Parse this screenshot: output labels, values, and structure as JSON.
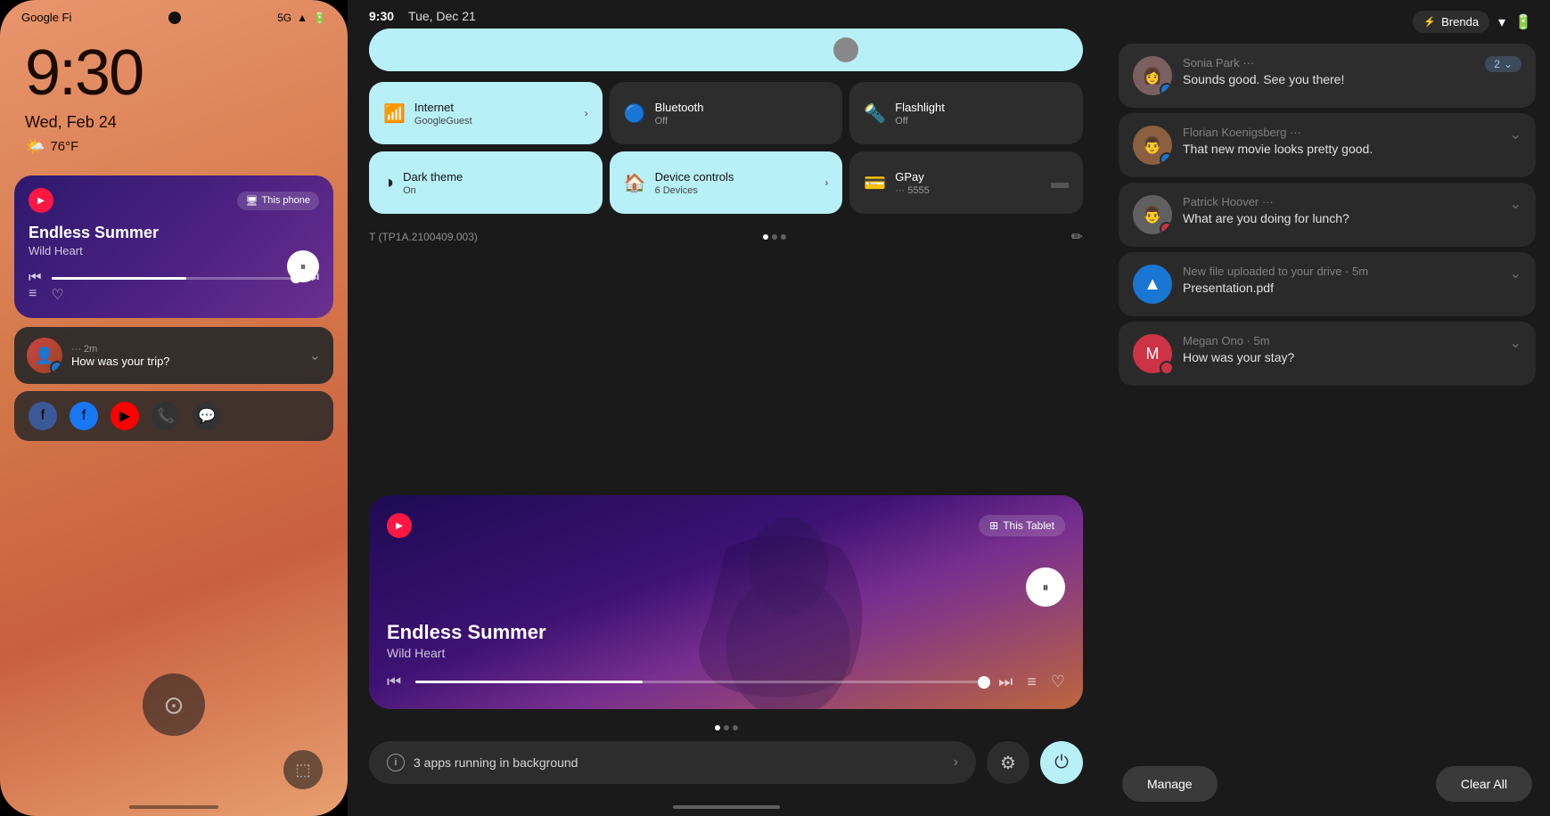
{
  "phone": {
    "carrier": "Google Fi",
    "network": "5G",
    "time": "9:30",
    "date": "Wed, Feb 24",
    "weather": "76°F",
    "weather_icon": "🌤",
    "music": {
      "title": "Endless Summer",
      "artist": "Wild Heart",
      "this_device_label": "This phone",
      "pause_icon": "⏸"
    },
    "notification": {
      "sender": "···  2m",
      "message": "How was your trip?",
      "expand_icon": "⌄"
    },
    "fingerprint_icon": "⊙",
    "recents_icon": "⬚"
  },
  "tablet": {
    "status_time": "9:30",
    "status_date": "Tue, Dec 21",
    "brightness_icon": "☀",
    "quick_settings": {
      "internet": {
        "label": "Internet",
        "sub": "GoogleGuest",
        "active": true,
        "icon": "📶"
      },
      "bluetooth": {
        "label": "Bluetooth",
        "sub": "Off",
        "active": false,
        "icon": "🔵"
      },
      "flashlight": {
        "label": "Flashlight",
        "sub": "Off",
        "active": false,
        "icon": "🔦"
      },
      "dark_theme": {
        "label": "Dark theme",
        "sub": "On",
        "active": true,
        "icon": "◑"
      },
      "device_controls": {
        "label": "Device controls",
        "sub": "6 Devices",
        "active": true,
        "icon": "🏠",
        "has_arrow": true
      },
      "gpay": {
        "label": "GPay",
        "sub": "··· 5555",
        "active": false,
        "icon": "💳"
      }
    },
    "device_build": "T (TP1A.2100409.003)",
    "music": {
      "title": "Endless Summer",
      "artist": "Wild Heart",
      "this_device_label": "This Tablet"
    },
    "background_apps": "3 apps running in background",
    "settings_icon": "⚙",
    "power_icon": "⏻"
  },
  "notifications": {
    "user_name": "Brenda",
    "items": [
      {
        "sender": "Sonia Park ···",
        "message": "Sounds good. See you there!",
        "has_count": true,
        "count": "2",
        "avatar_color": "#7a6060",
        "app_badge_color": "#1976d2"
      },
      {
        "sender": "Florian Koenigsberg ···",
        "message": "That new movie looks pretty good.",
        "has_count": false,
        "avatar_color": "#8a6040",
        "app_badge_color": "#1976d2"
      },
      {
        "sender": "Patrick Hoover ···",
        "message": "What are you doing for lunch?",
        "has_count": false,
        "avatar_color": "#606060",
        "app_badge_color": "#cc3344"
      },
      {
        "sender": "New file uploaded to your drive",
        "time": "5m",
        "message": "Presentation.pdf",
        "has_count": false,
        "type": "drive"
      },
      {
        "sender": "Megan Ono",
        "time": "5m",
        "message": "How was your stay?",
        "has_count": false,
        "avatar_color": "#cc3344",
        "type": "message"
      }
    ],
    "manage_label": "Manage",
    "clear_all_label": "Clear All"
  }
}
